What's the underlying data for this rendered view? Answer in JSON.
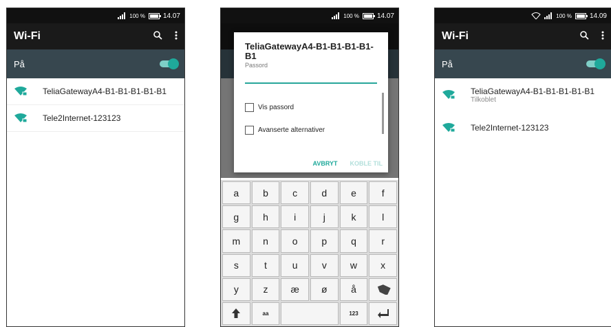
{
  "colors": {
    "accent": "#1fa99b",
    "appbar": "#1a1a1a",
    "toggle_row": "#37474f"
  },
  "screen1": {
    "status": {
      "battery": "100 %",
      "time": "14.07"
    },
    "title": "Wi-Fi",
    "toggle_label": "På",
    "networks": [
      {
        "name": "TeliaGatewayA4-B1-B1-B1-B1-B1"
      },
      {
        "name": "Tele2Internet-123123"
      }
    ]
  },
  "screen2": {
    "status": {
      "battery": "100 %",
      "time": "14.07"
    },
    "dialog": {
      "title": "TeliaGatewayA4-B1-B1-B1-B1-B1",
      "password_label": "Passord",
      "show_password": "Vis passord",
      "advanced": "Avanserte alternativer",
      "cancel": "AVBRYT",
      "connect": "KOBLE TIL"
    },
    "keyboard": {
      "row1": [
        "a",
        "b",
        "c",
        "d",
        "e",
        "f"
      ],
      "row2": [
        "g",
        "h",
        "i",
        "j",
        "k",
        "l"
      ],
      "row3": [
        "m",
        "n",
        "o",
        "p",
        "q",
        "r"
      ],
      "row4": [
        "s",
        "t",
        "u",
        "v",
        "w",
        "x"
      ],
      "row5": [
        "y",
        "z",
        "æ",
        "ø",
        "å"
      ],
      "shift_label": "aa",
      "numbers_label": "123"
    }
  },
  "screen3": {
    "status": {
      "battery": "100 %",
      "time": "14.09"
    },
    "title": "Wi-Fi",
    "toggle_label": "På",
    "networks": [
      {
        "name": "TeliaGatewayA4-B1-B1-B1-B1-B1",
        "status": "Tilkoblet"
      },
      {
        "name": "Tele2Internet-123123"
      }
    ]
  }
}
